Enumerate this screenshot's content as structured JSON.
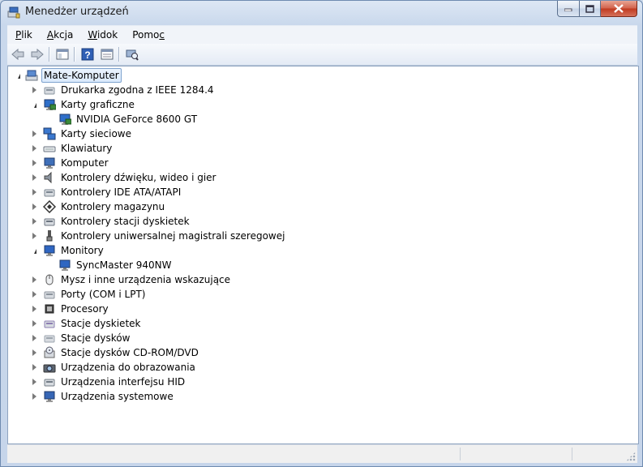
{
  "window": {
    "title": "Menedżer urządzeń"
  },
  "menu": [
    {
      "label": "Plik",
      "key": "P",
      "rest": "lik"
    },
    {
      "label": "Akcja",
      "key": "A",
      "rest": "kcja"
    },
    {
      "label": "Widok",
      "key": "W",
      "rest": "idok"
    },
    {
      "label": "Pomoc",
      "key": "c",
      "pre": "Pomo"
    }
  ],
  "toolbar": [
    "back-icon",
    "forward-icon",
    "show-hide-tree-icon",
    "help-icon",
    "properties-icon",
    "scan-hardware-icon"
  ],
  "tree": {
    "root": "Mate-Komputer",
    "items": [
      {
        "label": "Drukarka zgodna z IEEE 1284.4",
        "icon": "printer-port-icon",
        "expanded": false,
        "children": []
      },
      {
        "label": "Karty graficzne",
        "icon": "display-adapter-icon",
        "expanded": true,
        "children": [
          "NVIDIA GeForce 8600 GT"
        ]
      },
      {
        "label": "Karty sieciowe",
        "icon": "network-adapter-icon",
        "expanded": false,
        "children": []
      },
      {
        "label": "Klawiatury",
        "icon": "keyboard-icon",
        "expanded": false,
        "children": []
      },
      {
        "label": "Komputer",
        "icon": "computer-icon",
        "expanded": false,
        "children": []
      },
      {
        "label": "Kontrolery dźwięku, wideo i gier",
        "icon": "speaker-icon",
        "expanded": false,
        "children": []
      },
      {
        "label": "Kontrolery IDE ATA/ATAPI",
        "icon": "ide-controller-icon",
        "expanded": false,
        "children": []
      },
      {
        "label": "Kontrolery magazynu",
        "icon": "storage-controller-icon",
        "expanded": false,
        "children": []
      },
      {
        "label": "Kontrolery stacji dyskietek",
        "icon": "floppy-controller-icon",
        "expanded": false,
        "children": []
      },
      {
        "label": "Kontrolery uniwersalnej magistrali szeregowej",
        "icon": "usb-controller-icon",
        "expanded": false,
        "children": []
      },
      {
        "label": "Monitory",
        "icon": "monitor-icon",
        "expanded": true,
        "children": [
          "SyncMaster 940NW"
        ]
      },
      {
        "label": "Mysz i inne urządzenia wskazujące",
        "icon": "mouse-icon",
        "expanded": false,
        "children": []
      },
      {
        "label": "Porty (COM i LPT)",
        "icon": "port-icon",
        "expanded": false,
        "children": []
      },
      {
        "label": "Procesory",
        "icon": "processor-icon",
        "expanded": false,
        "children": []
      },
      {
        "label": "Stacje dyskietek",
        "icon": "floppy-drive-icon",
        "expanded": false,
        "children": []
      },
      {
        "label": "Stacje dysków",
        "icon": "disk-drive-icon",
        "expanded": false,
        "children": []
      },
      {
        "label": "Stacje dysków CD-ROM/DVD",
        "icon": "cdrom-icon",
        "expanded": false,
        "children": []
      },
      {
        "label": "Urządzenia do obrazowania",
        "icon": "camera-icon",
        "expanded": false,
        "children": []
      },
      {
        "label": "Urządzenia interfejsu HID",
        "icon": "hid-icon",
        "expanded": false,
        "children": []
      },
      {
        "label": "Urządzenia systemowe",
        "icon": "system-device-icon",
        "expanded": false,
        "children": []
      }
    ]
  }
}
